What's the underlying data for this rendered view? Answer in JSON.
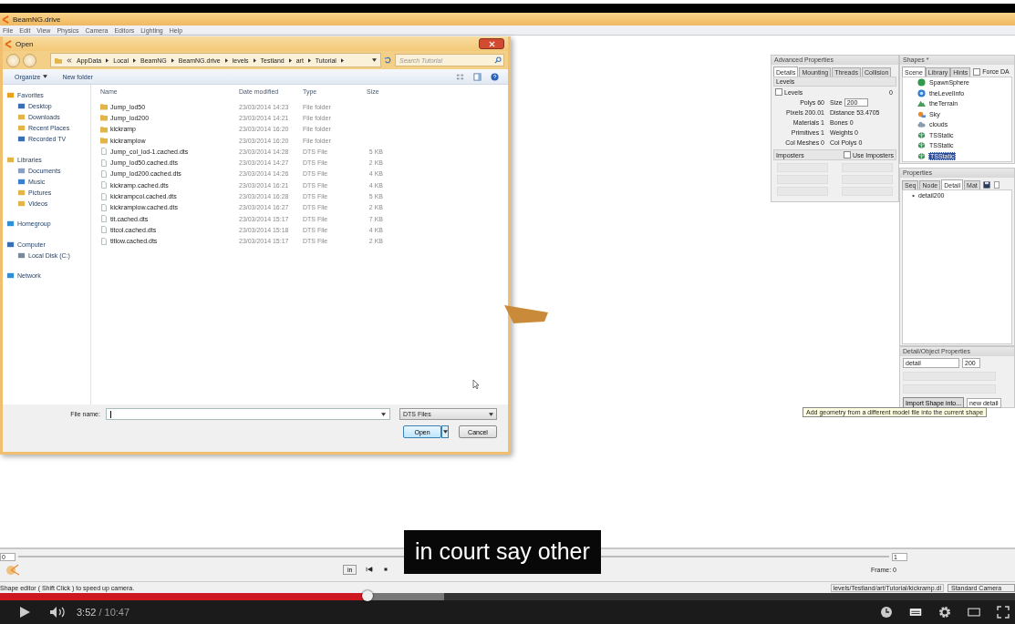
{
  "video_frame": {
    "app": {
      "title": "BeamNG.drive",
      "menu": [
        "File",
        "Edit",
        "View",
        "Physics",
        "Camera",
        "Editors",
        "Lighting",
        "Help"
      ]
    },
    "open_dialog": {
      "title": "Open",
      "breadcrumb": [
        "AppData",
        "Local",
        "BeamNG",
        "BeamNG.drive",
        "levels",
        "Testland",
        "art",
        "Tutorial"
      ],
      "search": {
        "placeholder": "Search Tutorial"
      },
      "toolbar": [
        "Organize",
        "New folder"
      ],
      "sidebar": [
        {
          "label": "Favorites",
          "kind": "star",
          "children": [
            {
              "label": "Desktop",
              "kind": "monitor"
            },
            {
              "label": "Downloads",
              "kind": "folder"
            },
            {
              "label": "Recent Places",
              "kind": "folder"
            },
            {
              "label": "Recorded TV",
              "kind": "monitor"
            }
          ]
        },
        {
          "label": "Libraries",
          "kind": "folder",
          "children": [
            {
              "label": "Documents",
              "kind": "page"
            },
            {
              "label": "Music",
              "kind": "note"
            },
            {
              "label": "Pictures",
              "kind": "folder"
            },
            {
              "label": "Videos",
              "kind": "folder"
            }
          ]
        },
        {
          "label": "Homegroup",
          "kind": "globe"
        },
        {
          "label": "Computer",
          "kind": "monitor",
          "children": [
            {
              "label": "Local Disk (C:)",
              "kind": "disk"
            }
          ]
        },
        {
          "label": "Network",
          "kind": "globe"
        }
      ],
      "columns": [
        "Name",
        "Date modified",
        "Type",
        "Size"
      ],
      "rows": [
        {
          "kind": "folder",
          "name": "Jump_lod50",
          "date": "23/03/2014 14:23",
          "type": "File folder"
        },
        {
          "kind": "folder",
          "name": "Jump_lod200",
          "date": "23/03/2014 14:21",
          "type": "File folder"
        },
        {
          "kind": "folder",
          "name": "kickramp",
          "date": "23/03/2014 16:20",
          "type": "File folder"
        },
        {
          "kind": "folder",
          "name": "kickramplow",
          "date": "23/03/2014 16:20",
          "type": "File folder"
        },
        {
          "kind": "file",
          "name": "Jump_col_lod-1.cached.dts",
          "date": "23/03/2014 14:28",
          "type": "DTS File",
          "size": "5 KB"
        },
        {
          "kind": "file",
          "name": "Jump_lod50.cached.dts",
          "date": "23/03/2014 14:27",
          "type": "DTS File",
          "size": "2 KB"
        },
        {
          "kind": "file",
          "name": "Jump_lod200.cached.dts",
          "date": "23/03/2014 14:26",
          "type": "DTS File",
          "size": "4 KB"
        },
        {
          "kind": "file",
          "name": "kickramp.cached.dts",
          "date": "23/03/2014 16:21",
          "type": "DTS File",
          "size": "4 KB"
        },
        {
          "kind": "file",
          "name": "kickrampcol.cached.dts",
          "date": "23/03/2014 16:28",
          "type": "DTS File",
          "size": "5 KB"
        },
        {
          "kind": "file",
          "name": "kickramplow.cached.dts",
          "date": "23/03/2014 16:27",
          "type": "DTS File",
          "size": "2 KB"
        },
        {
          "kind": "file",
          "name": "tit.cached.dts",
          "date": "23/03/2014 15:17",
          "type": "DTS File",
          "size": "7 KB"
        },
        {
          "kind": "file",
          "name": "titcol.cached.dts",
          "date": "23/03/2014 15:18",
          "type": "DTS File",
          "size": "4 KB"
        },
        {
          "kind": "file",
          "name": "titlow.cached.dts",
          "date": "23/03/2014 15:17",
          "type": "DTS File",
          "size": "2 KB"
        }
      ],
      "file_name_label": "File name:",
      "filter": "DTS Files",
      "buttons": [
        "Open",
        "Cancel"
      ]
    },
    "advanced_properties": {
      "title": "Advanced Properties",
      "tabs": [
        {
          "label": "Details",
          "selected": true
        },
        {
          "label": "Mounting",
          "selected": false
        },
        {
          "label": "Threads",
          "selected": false
        },
        {
          "label": "Collision",
          "selected": false
        }
      ],
      "levels_heading": "Levels",
      "levels_checkbox": {
        "label": "Levels",
        "checked": false
      },
      "levels_value": "0",
      "stats": [
        [
          "Polys 60",
          "Size"
        ],
        [
          "Pixels 200.01",
          "Distance 53.4705"
        ],
        [
          "Materials 1",
          "Bones 0"
        ],
        [
          "Primitives 1",
          "Weights 0"
        ],
        [
          "Col Meshes 0",
          "Col Polys 0"
        ]
      ],
      "size_value": "200",
      "imposters_heading": "Imposters",
      "imposters_checkbox": {
        "label": "Use Imposters",
        "checked": false
      }
    },
    "shapes": {
      "title": "Shapes *",
      "tabs": [
        {
          "label": "Scene",
          "selected": true
        },
        {
          "label": "Library",
          "selected": false
        },
        {
          "label": "Hints",
          "selected": false
        }
      ],
      "force_checkbox": {
        "label": "Force DA",
        "checked": false
      },
      "items": [
        {
          "label": "SpawnSphere",
          "kind": "spawn",
          "selected": false
        },
        {
          "label": "theLevelInfo",
          "kind": "info",
          "selected": false
        },
        {
          "label": "theTerrain",
          "kind": "terrain",
          "selected": false
        },
        {
          "label": "Sky",
          "kind": "sky",
          "selected": false
        },
        {
          "label": "clouds",
          "kind": "clouds",
          "selected": false
        },
        {
          "label": "TSStatic",
          "kind": "static",
          "selected": false
        },
        {
          "label": "TSStatic",
          "kind": "static",
          "selected": false
        },
        {
          "label": "TSStatic",
          "kind": "static",
          "selected": true
        }
      ]
    },
    "properties": {
      "title": "Properties",
      "tabs": [
        {
          "label": "Seq",
          "selected": false
        },
        {
          "label": "Node",
          "selected": false
        },
        {
          "label": "Detail",
          "selected": true
        },
        {
          "label": "Mat",
          "selected": false
        }
      ],
      "tree": [
        "detail200"
      ]
    },
    "detail_object_properties": {
      "title": "Detail/Object Properties",
      "name_value": "detail",
      "size_value": "200",
      "import_button": "Import Shape into...",
      "new_detail": "new detail"
    },
    "tooltip": "Add geometry from a different model file into the current shape",
    "timeline": {
      "start": "0",
      "end": "1",
      "in_button": "in",
      "frame": "Frame: 0"
    },
    "status_bar": {
      "hint": "Shape editor ( Shift Click ) to speed up camera.",
      "path": "levels/Testland/art/Tutorial/kickramp.dl",
      "camera": "Standard Camera"
    }
  },
  "caption": "in court say other",
  "player": {
    "progress": {
      "level": 0.362
    },
    "buffer": {
      "level": 0.438
    },
    "current_time": "3:52",
    "duration": "/ 10:47"
  }
}
